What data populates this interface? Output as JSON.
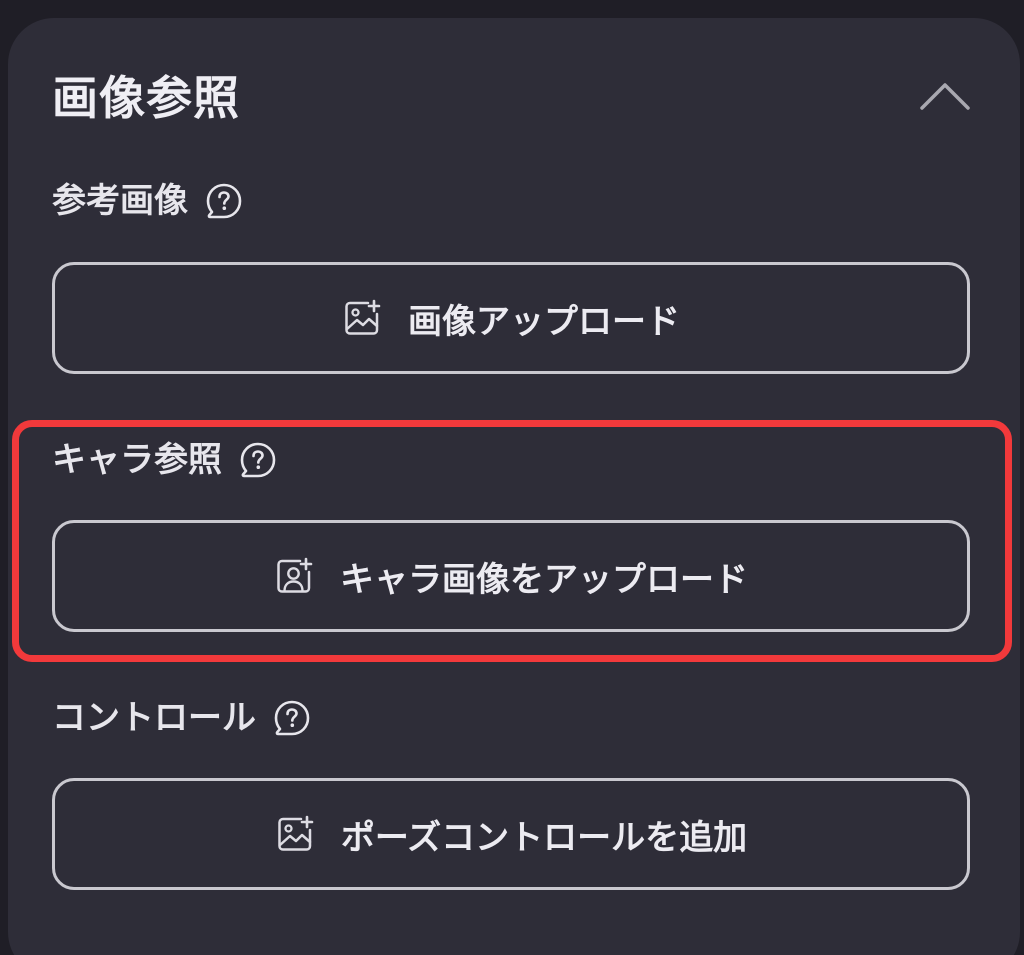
{
  "panel": {
    "title": "画像参照",
    "collapse_icon": "chevron-up-icon"
  },
  "sections": {
    "reference": {
      "label": "参考画像",
      "help_icon": "help-bubble-icon",
      "button_icon": "image-add-icon",
      "button_label": "画像アップロード"
    },
    "character": {
      "label": "キャラ参照",
      "help_icon": "help-bubble-icon",
      "button_icon": "person-add-icon",
      "button_label": "キャラ画像をアップロード"
    },
    "control": {
      "label": "コントロール",
      "help_icon": "help-bubble-icon",
      "button_icon": "image-add-icon",
      "button_label": "ポーズコントロールを追加"
    }
  },
  "colors": {
    "background": "#1f1e26",
    "panel": "#2e2d38",
    "text": "#ecebf1",
    "button_border": "#c9c8cf",
    "highlight": "#f2393b"
  }
}
